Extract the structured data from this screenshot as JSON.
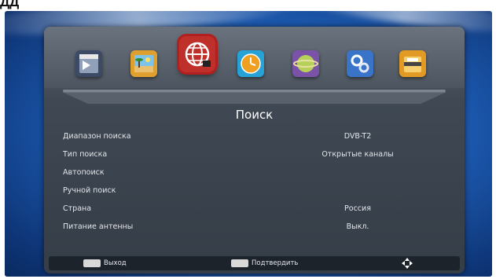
{
  "top_label": "ДД",
  "menu": {
    "title": "Поиск",
    "icons": [
      {
        "name": "video-clapper-icon",
        "color": "#3d4a66"
      },
      {
        "name": "picture-icon",
        "color": "#e0a030"
      },
      {
        "name": "globe-icon",
        "color": "#c0302a",
        "selected": true
      },
      {
        "name": "clock-icon",
        "color": "#27a2d6"
      },
      {
        "name": "planet-icon",
        "color": "#7a52a8"
      },
      {
        "name": "gear-icon",
        "color": "#3a74c8"
      },
      {
        "name": "folder-icon",
        "color": "#e29a24"
      }
    ],
    "rows": [
      {
        "label": "Диапазон поиска",
        "value": "DVB-T2"
      },
      {
        "label": "Тип поиска",
        "value": "Открытые каналы"
      },
      {
        "label": "Автопоиск",
        "value": ""
      },
      {
        "label": "Ручной поиск",
        "value": ""
      },
      {
        "label": "Страна",
        "value": "Россия"
      },
      {
        "label": "Питание антенны",
        "value": "Выкл."
      }
    ]
  },
  "footer": {
    "exit_label": "Выход",
    "ok_label": "Подтвердить",
    "nav_icon": "dpad-icon"
  }
}
